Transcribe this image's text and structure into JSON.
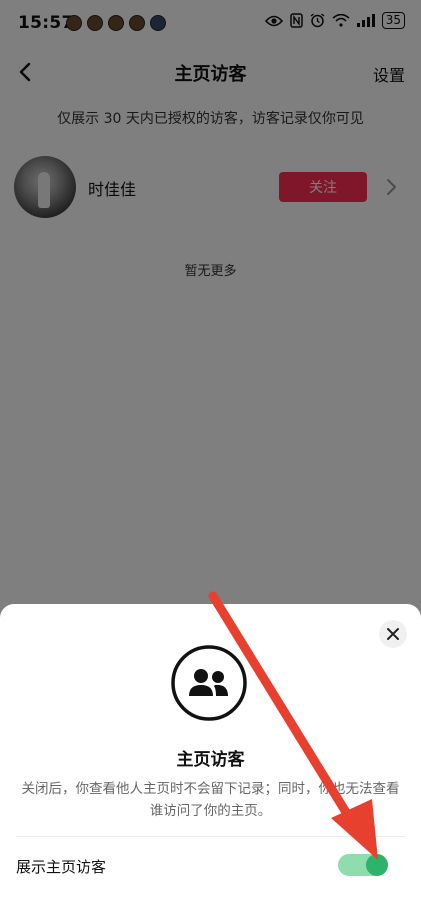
{
  "status_bar": {
    "time": "15:57",
    "battery": "35",
    "icons": [
      "eye-icon",
      "nfc-icon",
      "alarm-icon",
      "wifi-icon",
      "signal-icon",
      "battery-icon"
    ]
  },
  "header": {
    "title": "主页访客",
    "settings_label": "设置",
    "back_icon": "chevron-left-icon"
  },
  "notice": "仅展示 30 天内已授权的访客，访客记录仅你可见",
  "visitors": [
    {
      "name": "时佳佳",
      "follow_label": "关注"
    }
  ],
  "no_more": "暂无更多",
  "sheet": {
    "title": "主页访客",
    "description": "关闭后，你查看他人主页时不会留下记录；同时，你也无法查看谁访问了你的主页。",
    "toggle_label": "展示主页访客",
    "toggle_on": true,
    "close_icon": "close-icon",
    "main_icon": "users-icon"
  },
  "colors": {
    "follow_button": "#fe2c55",
    "toggle_track": "#8fdcae",
    "toggle_knob": "#2db36a",
    "annotation_arrow": "#e8402f"
  }
}
